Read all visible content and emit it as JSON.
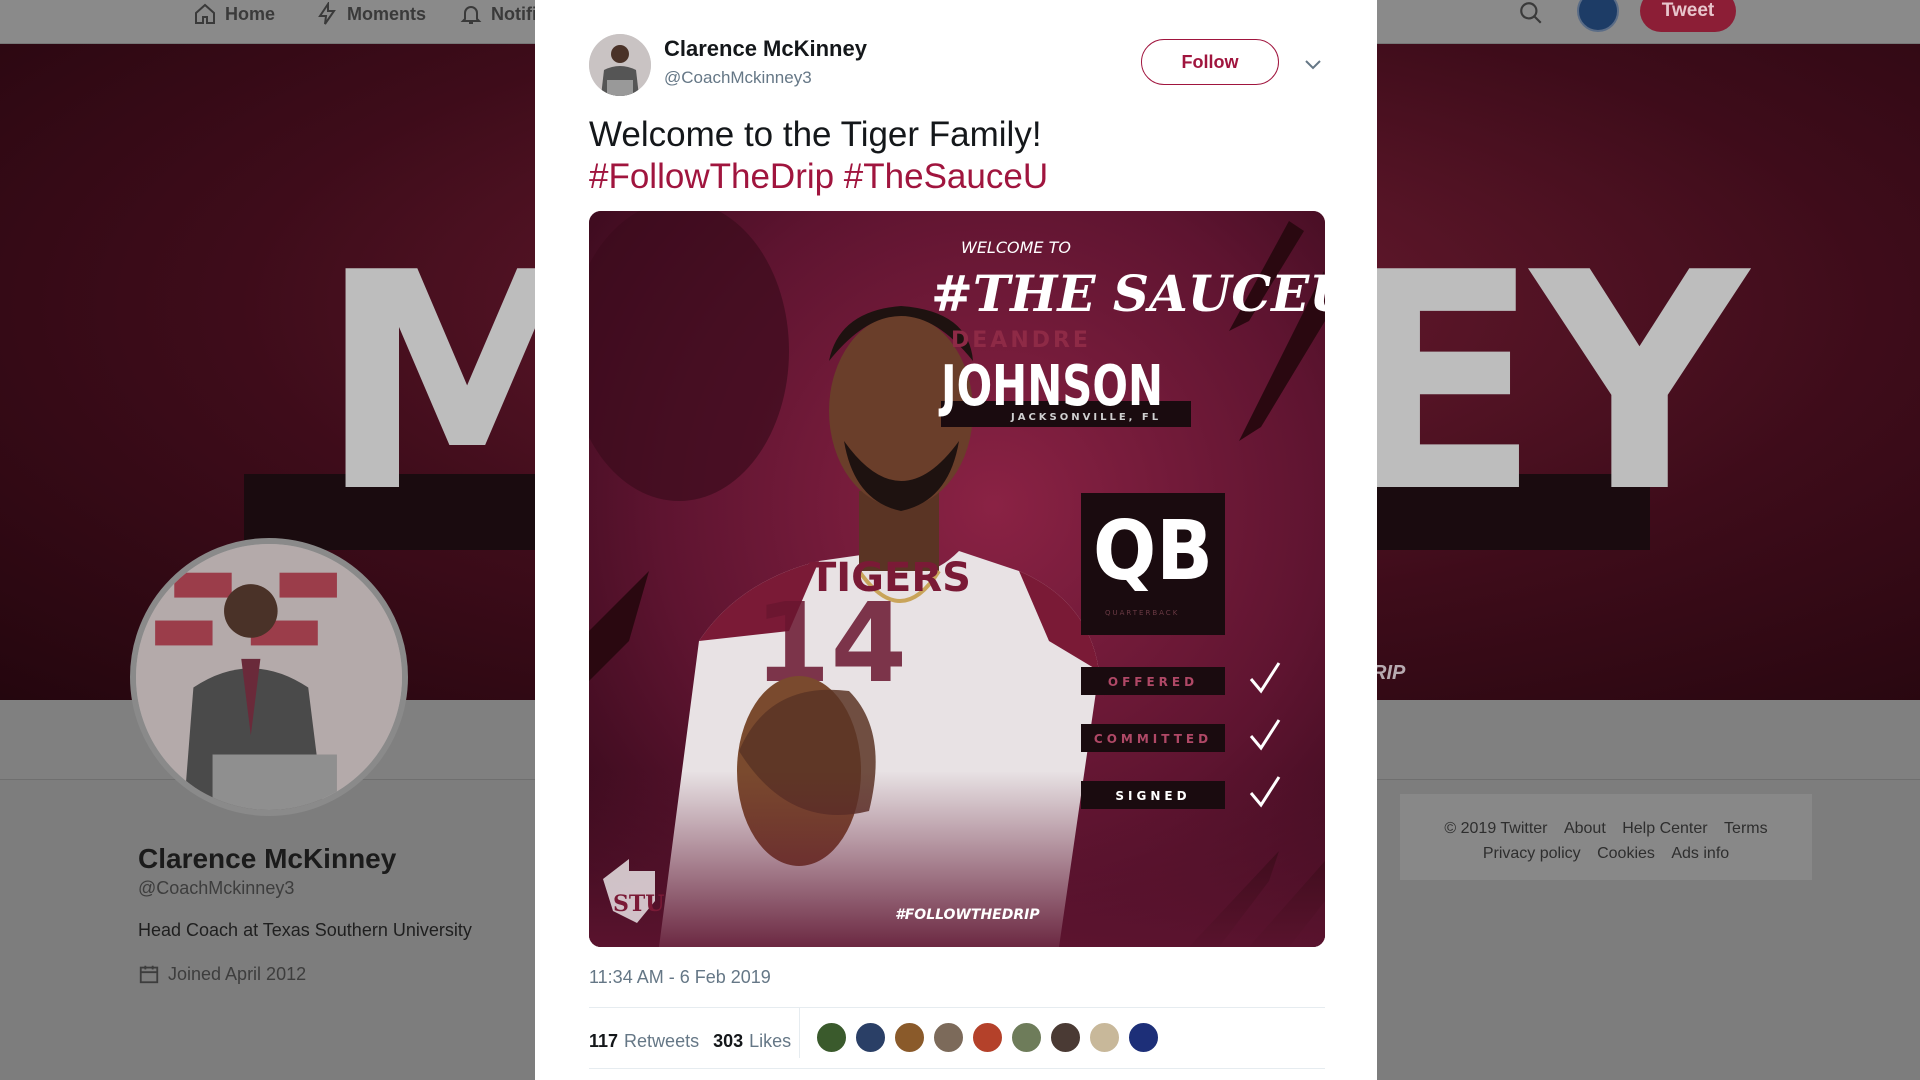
{
  "nav": {
    "home_label": "Home",
    "moments_label": "Moments",
    "notifications_label": "Notifi",
    "tweet_label": "Tweet"
  },
  "banner": {
    "left_letters": "M",
    "right_letters": "EY",
    "tag_fragment": "RIP"
  },
  "profile": {
    "name": "Clarence McKinney",
    "handle": "@CoachMckinney3",
    "bio": "Head Coach at Texas Southern University",
    "joined": "Joined April 2012"
  },
  "footer": {
    "row1": [
      "© 2019 Twitter",
      "About",
      "Help Center",
      "Terms"
    ],
    "row2": [
      "Privacy policy",
      "Cookies",
      "Ads info"
    ]
  },
  "tweet": {
    "author_name": "Clarence McKinney",
    "author_handle": "@CoachMckinney3",
    "follow_label": "Follow",
    "text": "Welcome to the Tiger Family!",
    "hashtags": "#FollowTheDrip #TheSauceU",
    "timestamp": "11:34 AM - 6 Feb 2019",
    "retweets_count": "117",
    "retweets_label": "Retweets",
    "likes_count": "303",
    "likes_label": "Likes",
    "liker_colors": [
      "#3a5a2c",
      "#2a3f66",
      "#8a5a2a",
      "#7c6a5a",
      "#b4412a",
      "#6e7c5a",
      "#4a3a34",
      "#c8b89a",
      "#1d2f78"
    ]
  },
  "graphic": {
    "welcome": "WELCOME TO",
    "brand": "#THE SAUCEU",
    "first_name": "DEANDRE",
    "last_name": "JOHNSON",
    "hometown": "JACKSONVILLE, FL",
    "jersey_text": "TIGERS",
    "jersey_number": "14",
    "position": "QB",
    "position_full": "QUARTERBACK",
    "status_items": [
      "OFFERED",
      "COMMITTED",
      "SIGNED"
    ],
    "footer_tag": "#FOLLOWTHEDRIP",
    "logo_text": "STU"
  },
  "colors": {
    "accent": "#a0153e",
    "graphic_bg": "#6a1630",
    "graphic_dark": "#1a0b0f"
  }
}
